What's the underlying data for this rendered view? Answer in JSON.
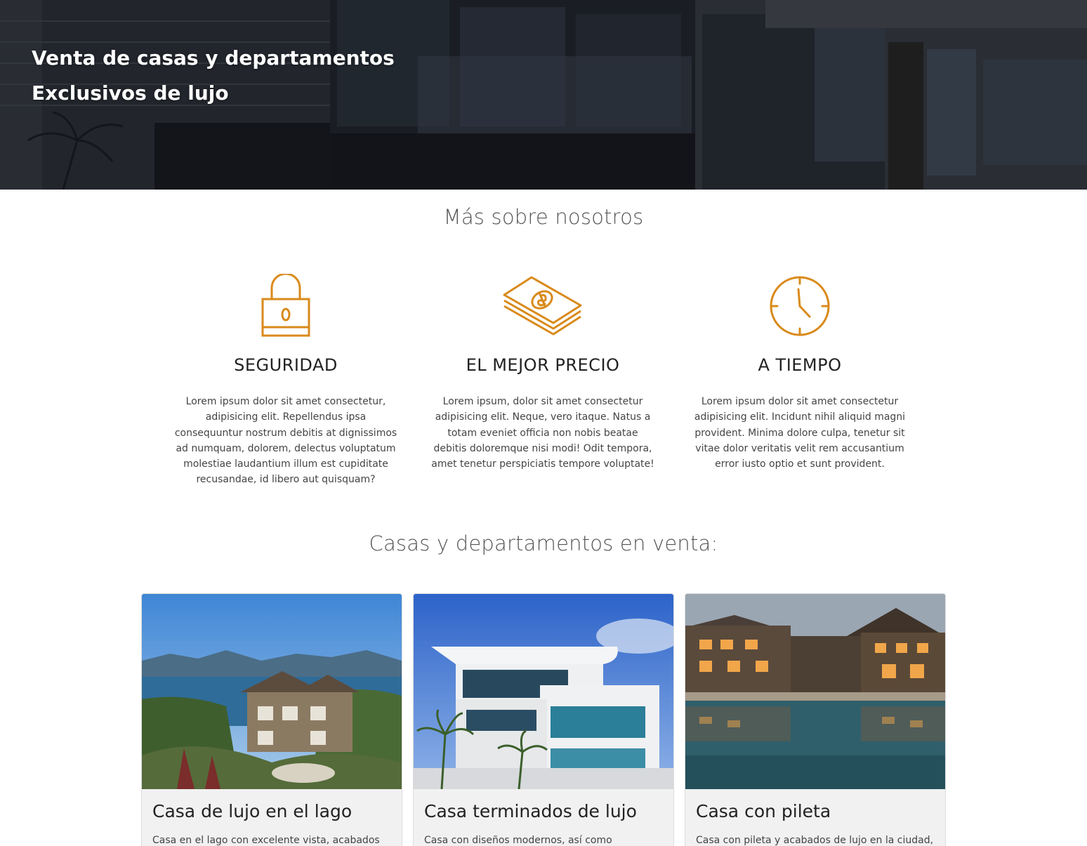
{
  "hero": {
    "line1": "Venta de casas y departamentos",
    "line2": "Exclusivos de lujo"
  },
  "about": {
    "title": "Más sobre nosotros",
    "features": [
      {
        "icon": "padlock-icon",
        "title": "SEGURIDAD",
        "text": "Lorem ipsum dolor sit amet consectetur, adipisicing elit. Repellendus ipsa consequuntur nostrum debitis at dignissimos ad numquam, dolorem, delectus voluptatum molestiae laudantium illum est cupiditate recusandae, id libero aut quisquam?"
      },
      {
        "icon": "money-stack-icon",
        "title": "EL MEJOR PRECIO",
        "text": "Lorem ipsum, dolor sit amet consectetur adipisicing elit. Neque, vero itaque. Natus a totam eveniet officia non nobis beatae debitis doloremque nisi modi! Odit tempora, amet tenetur perspiciatis tempore voluptate!"
      },
      {
        "icon": "clock-icon",
        "title": "A TIEMPO",
        "text": "Lorem ipsum dolor sit amet consectetur adipisicing elit. Incidunt nihil aliquid magni provident. Minima dolore culpa, tenetur sit vitae dolor veritatis velit rem accusantium error iusto optio et sunt provident."
      }
    ]
  },
  "listings": {
    "title": "Casas y departamentos en venta:",
    "cards": [
      {
        "title": "Casa de lujo en el lago",
        "text": "Casa en el lago con excelente vista, acabados de"
      },
      {
        "title": "Casa terminados de lujo",
        "text": "Casa con diseños modernos, así como tecnología"
      },
      {
        "title": "Casa con pileta",
        "text": "Casa con pileta y acabados de lujo en la ciudad,"
      }
    ]
  },
  "colors": {
    "accent": "#d98a1b",
    "hero_overlay": "#23272f"
  }
}
